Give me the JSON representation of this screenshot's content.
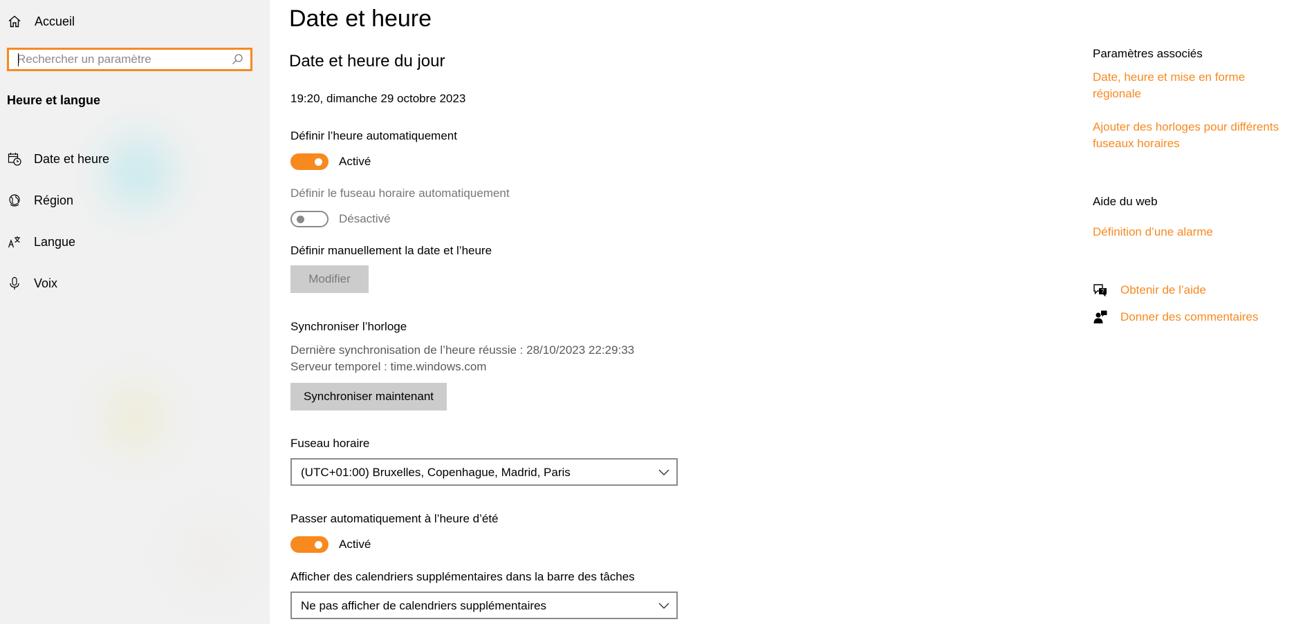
{
  "sidebar": {
    "home_label": "Accueil",
    "search_placeholder": "Rechercher un paramètre",
    "section_title": "Heure et langue",
    "items": [
      {
        "label": "Date et heure",
        "icon": "calendar-clock-icon"
      },
      {
        "label": "Région",
        "icon": "globe-icon"
      },
      {
        "label": "Langue",
        "icon": "language-icon"
      },
      {
        "label": "Voix",
        "icon": "microphone-icon"
      }
    ]
  },
  "main": {
    "page_title": "Date et heure",
    "section_title": "Date et heure du jour",
    "current_datetime": "19:20, dimanche 29 octobre 2023",
    "auto_time": {
      "label": "Définir l’heure automatiquement",
      "state": "Activé",
      "on": true
    },
    "auto_timezone": {
      "label": "Définir le fuseau horaire automatiquement",
      "state": "Désactivé",
      "on": false
    },
    "manual": {
      "label": "Définir manuellement la date et l’heure",
      "button": "Modifier"
    },
    "sync": {
      "title": "Synchroniser l’horloge",
      "last_sync": "Dernière synchronisation de l’heure réussie : 28/10/2023 22:29:33",
      "server": "Serveur temporel : time.windows.com",
      "button": "Synchroniser maintenant"
    },
    "timezone": {
      "label": "Fuseau horaire",
      "value": "(UTC+01:00) Bruxelles, Copenhague, Madrid, Paris"
    },
    "dst": {
      "label": "Passer automatiquement à l’heure d’été",
      "state": "Activé",
      "on": true
    },
    "calendars": {
      "label": "Afficher des calendriers supplémentaires dans la barre des tâches",
      "value": "Ne pas afficher de calendriers supplémentaires"
    }
  },
  "related": {
    "title": "Paramètres associés",
    "links": [
      "Date, heure et mise en forme régionale",
      "Ajouter des horloges pour différents fuseaux horaires"
    ],
    "web_help_title": "Aide du web",
    "web_help_link": "Définition d’une alarme",
    "get_help": "Obtenir de l’aide",
    "feedback": "Donner des commentaires"
  },
  "colors": {
    "accent": "#f7891f",
    "sidebar_bg": "#f1f1f1",
    "button_bg": "#cccccc",
    "muted_text": "#767676"
  }
}
